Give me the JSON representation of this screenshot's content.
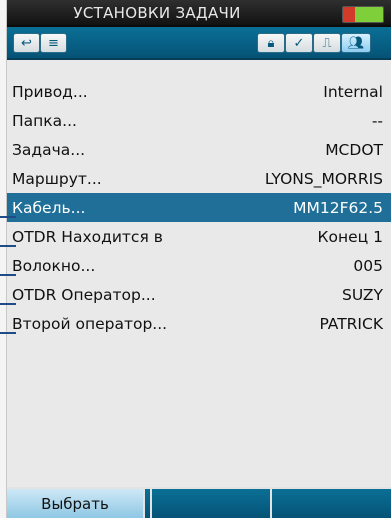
{
  "titlebar": {
    "title": "УСТАНОВКИ ЗАДАЧИ"
  },
  "toolbar": {
    "left_buttons": [
      {
        "icon": "back-arrow-icon",
        "glyph": "↩"
      },
      {
        "icon": "menu-icon",
        "glyph": "≡"
      }
    ],
    "right_buttons": [
      {
        "icon": "lock-icon",
        "glyph": "🔒︎",
        "selected": false
      },
      {
        "icon": "check-icon",
        "glyph": "✓",
        "selected": false
      },
      {
        "icon": "pulse-icon",
        "glyph": "⎍",
        "selected": false
      },
      {
        "icon": "users-icon",
        "glyph": "👥︎",
        "selected": true
      }
    ]
  },
  "settings": [
    {
      "label": "Привод...",
      "value": "Internal"
    },
    {
      "label": "Папка...",
      "value": "--"
    },
    {
      "label": "Задача...",
      "value": "MCDOT"
    },
    {
      "label": "Маршрут...",
      "value": "LYONS_MORRIS"
    },
    {
      "label": "Кабель...",
      "value": "MM12F62.5",
      "selected": true
    },
    {
      "label": "OTDR Находится в",
      "value": "Конец 1"
    },
    {
      "label": "Волокно...",
      "value": "005"
    },
    {
      "label": "OTDR Оператор...",
      "value": "SUZY"
    },
    {
      "label": "Второй оператор...",
      "value": "PATRICK"
    }
  ],
  "softkeys": [
    "Выбрать",
    "",
    "",
    ""
  ],
  "colors": {
    "accent": "#0b6f95",
    "selection": "#1f6f99",
    "callout": "#1f4b86"
  }
}
